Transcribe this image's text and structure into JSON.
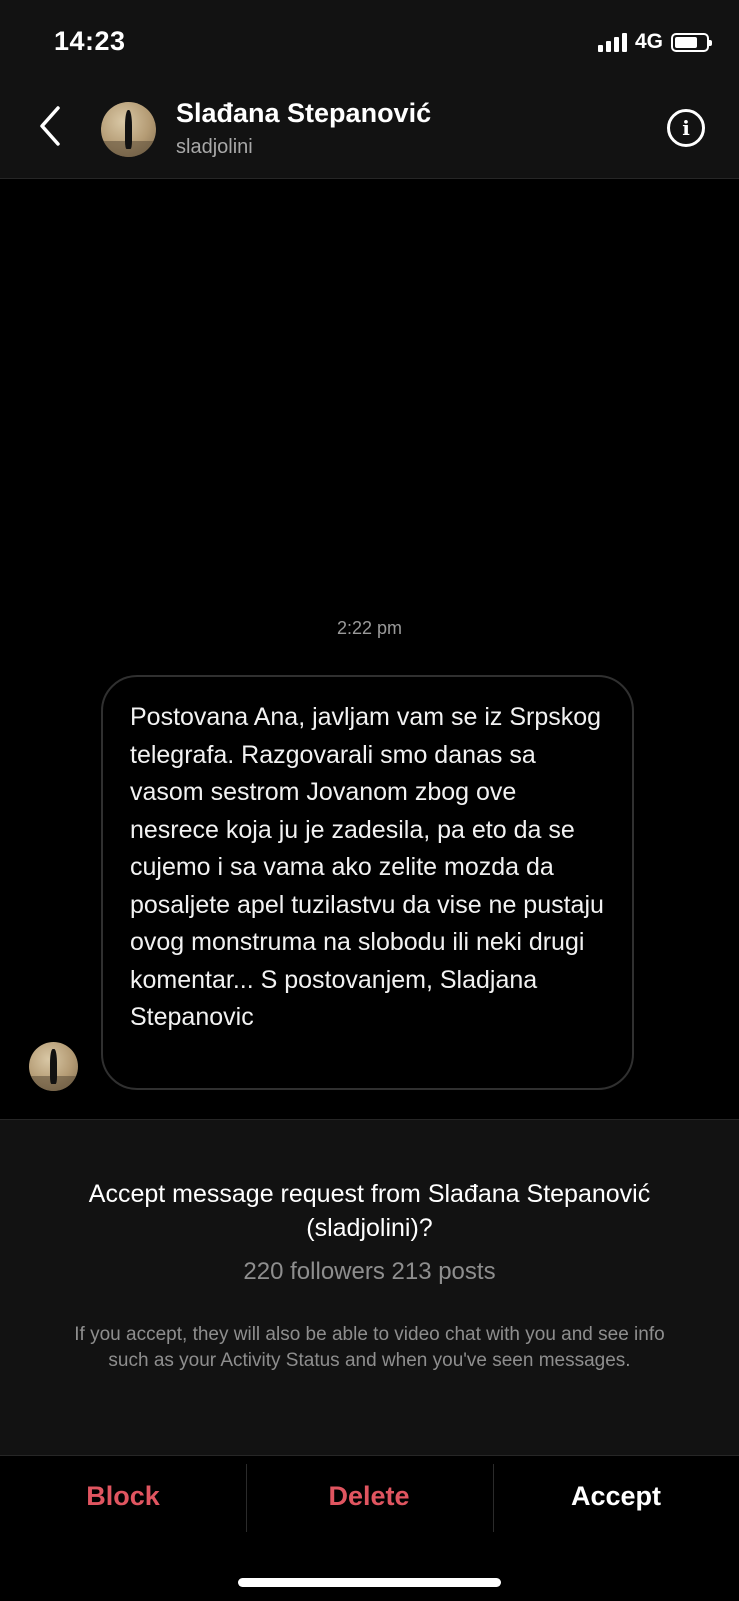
{
  "status_bar": {
    "time": "14:23",
    "network": "4G",
    "battery_level": 0.72
  },
  "header": {
    "name": "Slađana Stepanović",
    "username": "sladjolini",
    "back_icon": "chevron-left-icon",
    "info_icon": "info-icon",
    "info_glyph": "i"
  },
  "thread": {
    "timestamp": "2:22 pm",
    "message": "Postovana Ana, javljam vam se iz Srpskog telegrafa. Razgovarali smo danas sa vasom sestrom Jovanom zbog ove nesrece koja ju je zadesila, pa eto da se cujemo i sa vama ako zelite mozda da posaljete apel tuzilastvu da vise ne pustaju ovog monstruma na slobodu ili neki drugi komentar... S postovanjem, Sladjana Stepanovic"
  },
  "request": {
    "title": "Accept message request from Slađana Stepanović (sladjolini)?",
    "stats": "220 followers 213 posts",
    "note": "If you accept, they will also be able to video chat with you and see info such as your Activity Status and when you've seen messages."
  },
  "actions": {
    "block": "Block",
    "delete": "Delete",
    "accept": "Accept"
  },
  "colors": {
    "destructive": "#e05560",
    "background": "#000000",
    "panel": "#121212"
  }
}
